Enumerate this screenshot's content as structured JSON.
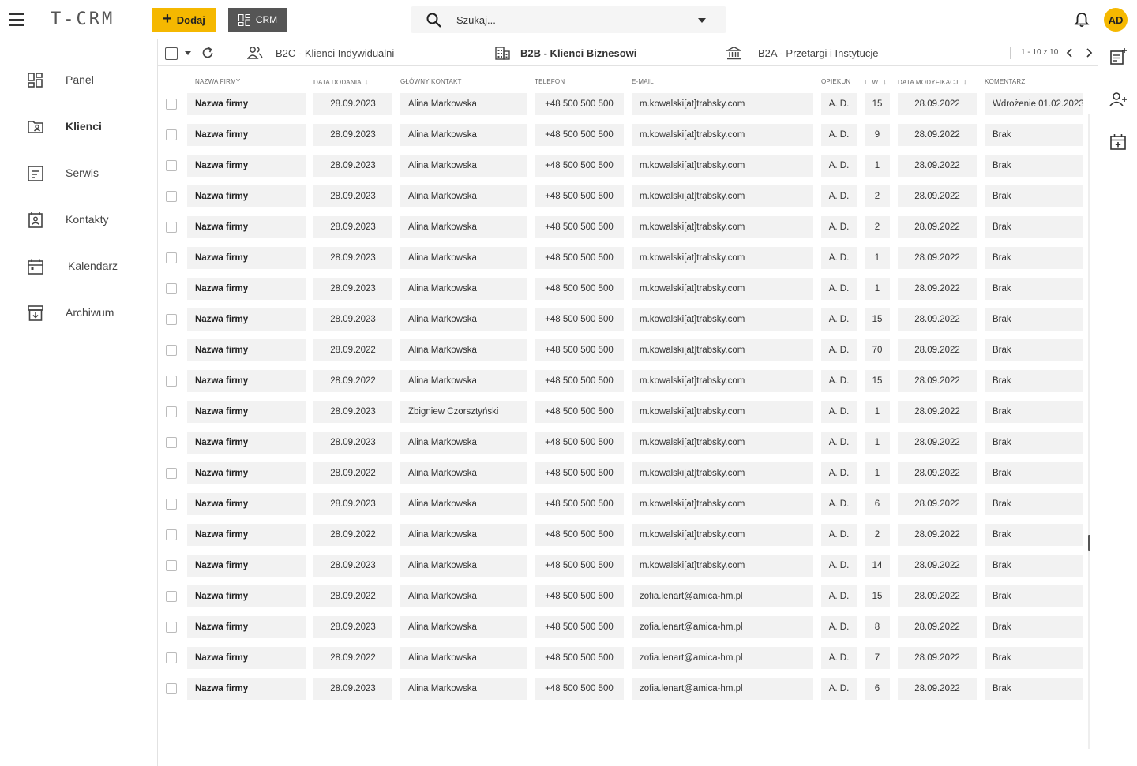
{
  "app": {
    "logo": "T-CRM",
    "add_button": "Dodaj",
    "crm_button": "CRM",
    "search_placeholder": "Szukaj...",
    "avatar_initials": "AD",
    "accent_color": "#f5b800"
  },
  "sidebar": {
    "items": [
      {
        "label": "Panel",
        "icon": "dashboard-icon"
      },
      {
        "label": "Klienci",
        "icon": "folder-person-icon",
        "active": true
      },
      {
        "label": "Serwis",
        "icon": "service-list-icon"
      },
      {
        "label": "Kontakty",
        "icon": "contacts-icon"
      },
      {
        "label": "Kalendarz",
        "icon": "calendar-icon"
      },
      {
        "label": "Archiwum",
        "icon": "archive-icon"
      }
    ]
  },
  "toolbar": {
    "tabs": [
      {
        "label": "B2C - Klienci Indywidualni",
        "icon": "people-icon"
      },
      {
        "label": "B2B - Klienci Biznesowi",
        "icon": "building-icon",
        "active": true
      },
      {
        "label": "B2A - Przetargi i Instytucje",
        "icon": "institution-icon"
      }
    ],
    "pager": "1 - 10 z 10"
  },
  "table": {
    "headers": {
      "company": "NAZWA FIRMY",
      "date_added": "DATA DODANIA",
      "contact": "GŁÓWNY KONTAKT",
      "phone": "TELEFON",
      "email": "E-MAIL",
      "owner": "OPIEKUN",
      "lw": "L. W.",
      "modified": "DATA MODYFIKACJI",
      "comment": "KOMENTARZ"
    },
    "rows": [
      {
        "company": "Nazwa firmy",
        "date_added": "28.09.2023",
        "contact": "Alina Markowska",
        "phone": "+48 500 500 500",
        "email": "m.kowalski[at]trabsky.com",
        "owner": "A. D.",
        "lw": "15",
        "modified": "28.09.2022",
        "comment": "Wdrożenie 01.02.2023"
      },
      {
        "company": "Nazwa firmy",
        "date_added": "28.09.2023",
        "contact": "Alina Markowska",
        "phone": "+48 500 500 500",
        "email": "m.kowalski[at]trabsky.com",
        "owner": "A. D.",
        "lw": "9",
        "modified": "28.09.2022",
        "comment": "Brak"
      },
      {
        "company": "Nazwa firmy",
        "date_added": "28.09.2023",
        "contact": "Alina Markowska",
        "phone": "+48 500 500 500",
        "email": "m.kowalski[at]trabsky.com",
        "owner": "A. D.",
        "lw": "1",
        "modified": "28.09.2022",
        "comment": "Brak"
      },
      {
        "company": "Nazwa firmy",
        "date_added": "28.09.2023",
        "contact": "Alina Markowska",
        "phone": "+48 500 500 500",
        "email": "m.kowalski[at]trabsky.com",
        "owner": "A. D.",
        "lw": "2",
        "modified": "28.09.2022",
        "comment": "Brak"
      },
      {
        "company": "Nazwa firmy",
        "date_added": "28.09.2023",
        "contact": "Alina Markowska",
        "phone": "+48 500 500 500",
        "email": "m.kowalski[at]trabsky.com",
        "owner": "A. D.",
        "lw": "2",
        "modified": "28.09.2022",
        "comment": "Brak"
      },
      {
        "company": "Nazwa firmy",
        "date_added": "28.09.2023",
        "contact": "Alina Markowska",
        "phone": "+48 500 500 500",
        "email": "m.kowalski[at]trabsky.com",
        "owner": "A. D.",
        "lw": "1",
        "modified": "28.09.2022",
        "comment": "Brak"
      },
      {
        "company": "Nazwa firmy",
        "date_added": "28.09.2023",
        "contact": "Alina Markowska",
        "phone": "+48 500 500 500",
        "email": "m.kowalski[at]trabsky.com",
        "owner": "A. D.",
        "lw": "1",
        "modified": "28.09.2022",
        "comment": "Brak"
      },
      {
        "company": "Nazwa firmy",
        "date_added": "28.09.2023",
        "contact": "Alina Markowska",
        "phone": "+48 500 500 500",
        "email": "m.kowalski[at]trabsky.com",
        "owner": "A. D.",
        "lw": "15",
        "modified": "28.09.2022",
        "comment": "Brak"
      },
      {
        "company": "Nazwa firmy",
        "date_added": "28.09.2022",
        "contact": "Alina Markowska",
        "phone": "+48 500 500 500",
        "email": "m.kowalski[at]trabsky.com",
        "owner": "A. D.",
        "lw": "70",
        "modified": "28.09.2022",
        "comment": "Brak"
      },
      {
        "company": "Nazwa firmy",
        "date_added": "28.09.2022",
        "contact": "Alina Markowska",
        "phone": "+48 500 500 500",
        "email": "m.kowalski[at]trabsky.com",
        "owner": "A. D.",
        "lw": "15",
        "modified": "28.09.2022",
        "comment": "Brak"
      },
      {
        "company": "Nazwa firmy",
        "date_added": "28.09.2023",
        "contact": "Zbigniew Czorsztyński",
        "phone": "+48 500 500 500",
        "email": "m.kowalski[at]trabsky.com",
        "owner": "A. D.",
        "lw": "1",
        "modified": "28.09.2022",
        "comment": "Brak"
      },
      {
        "company": "Nazwa firmy",
        "date_added": "28.09.2023",
        "contact": "Alina Markowska",
        "phone": "+48 500 500 500",
        "email": "m.kowalski[at]trabsky.com",
        "owner": "A. D.",
        "lw": "1",
        "modified": "28.09.2022",
        "comment": "Brak"
      },
      {
        "company": "Nazwa firmy",
        "date_added": "28.09.2022",
        "contact": "Alina Markowska",
        "phone": "+48 500 500 500",
        "email": "m.kowalski[at]trabsky.com",
        "owner": "A. D.",
        "lw": "1",
        "modified": "28.09.2022",
        "comment": "Brak"
      },
      {
        "company": "Nazwa firmy",
        "date_added": "28.09.2023",
        "contact": "Alina Markowska",
        "phone": "+48 500 500 500",
        "email": "m.kowalski[at]trabsky.com",
        "owner": "A. D.",
        "lw": "6",
        "modified": "28.09.2022",
        "comment": "Brak"
      },
      {
        "company": "Nazwa firmy",
        "date_added": "28.09.2022",
        "contact": "Alina Markowska",
        "phone": "+48 500 500 500",
        "email": "m.kowalski[at]trabsky.com",
        "owner": "A. D.",
        "lw": "2",
        "modified": "28.09.2022",
        "comment": "Brak"
      },
      {
        "company": "Nazwa firmy",
        "date_added": "28.09.2023",
        "contact": "Alina Markowska",
        "phone": "+48 500 500 500",
        "email": "m.kowalski[at]trabsky.com",
        "owner": "A. D.",
        "lw": "14",
        "modified": "28.09.2022",
        "comment": "Brak"
      },
      {
        "company": "Nazwa firmy",
        "date_added": "28.09.2022",
        "contact": "Alina Markowska",
        "phone": "+48 500 500 500",
        "email": "zofia.lenart@amica-hm.pl",
        "owner": "A. D.",
        "lw": "15",
        "modified": "28.09.2022",
        "comment": "Brak"
      },
      {
        "company": "Nazwa firmy",
        "date_added": "28.09.2023",
        "contact": "Alina Markowska",
        "phone": "+48 500 500 500",
        "email": "zofia.lenart@amica-hm.pl",
        "owner": "A. D.",
        "lw": "8",
        "modified": "28.09.2022",
        "comment": "Brak"
      },
      {
        "company": "Nazwa firmy",
        "date_added": "28.09.2022",
        "contact": "Alina Markowska",
        "phone": "+48 500 500 500",
        "email": "zofia.lenart@amica-hm.pl",
        "owner": "A. D.",
        "lw": "7",
        "modified": "28.09.2022",
        "comment": "Brak"
      },
      {
        "company": "Nazwa firmy",
        "date_added": "28.09.2023",
        "contact": "Alina Markowska",
        "phone": "+48 500 500 500",
        "email": "zofia.lenart@amica-hm.pl",
        "owner": "A. D.",
        "lw": "6",
        "modified": "28.09.2022",
        "comment": "Brak"
      }
    ]
  }
}
